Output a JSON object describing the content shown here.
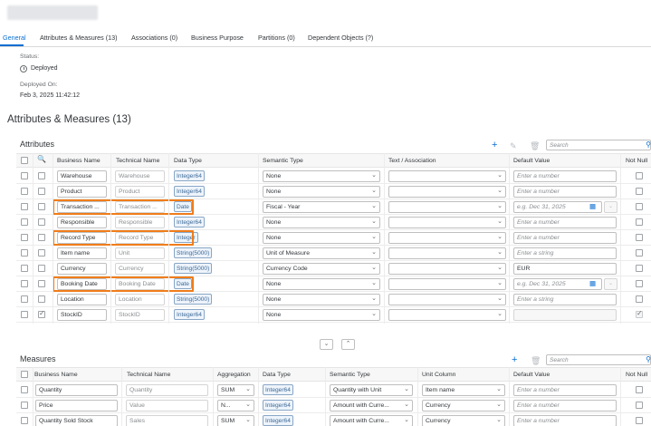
{
  "tabs": [
    {
      "label": "General",
      "active": true
    },
    {
      "label": "Attributes & Measures (13)"
    },
    {
      "label": "Associations (0)"
    },
    {
      "label": "Business Purpose"
    },
    {
      "label": "Partitions (0)"
    },
    {
      "label": "Dependent Objects (?)"
    }
  ],
  "general": {
    "status_label": "Status:",
    "status_value": "Deployed",
    "deployed_on_label": "Deployed On:",
    "deployed_on_value": "Feb 3, 2025 11:42:12"
  },
  "section_title": "Attributes & Measures (13)",
  "attributes": {
    "title": "Attributes",
    "search_placeholder": "Search",
    "headers": [
      "Business Name",
      "Technical Name",
      "Data Type",
      "Semantic Type",
      "Text / Association",
      "Default Value",
      "Not Null"
    ],
    "rows": [
      {
        "key": false,
        "business": "Warehouse",
        "technical": "Warehouse",
        "type": "Integer64",
        "semantic": "None",
        "text": "",
        "default": "Enter a number",
        "default_ph": true,
        "date": false,
        "notnull": false,
        "hl": false
      },
      {
        "key": false,
        "business": "Product",
        "technical": "Product",
        "type": "Integer64",
        "semantic": "None",
        "text": "",
        "default": "Enter a number",
        "default_ph": true,
        "date": false,
        "notnull": false,
        "hl": false
      },
      {
        "key": false,
        "business": "Transaction ...",
        "technical": "Transaction ...",
        "type": "Date",
        "semantic": "Fiscal - Year",
        "text": "",
        "default": "e.g. Dec 31, 2025",
        "default_ph": true,
        "date": true,
        "notnull": false,
        "hl": true
      },
      {
        "key": false,
        "business": "Responsible",
        "technical": "Responsible",
        "type": "Integer64",
        "semantic": "None",
        "text": "",
        "default": "Enter a number",
        "default_ph": true,
        "date": false,
        "notnull": false,
        "hl": false
      },
      {
        "key": false,
        "business": "Record Type",
        "technical": "Record Type",
        "type": "Integer",
        "semantic": "None",
        "text": "",
        "default": "Enter a number",
        "default_ph": true,
        "date": false,
        "notnull": false,
        "hl": true
      },
      {
        "key": false,
        "business": "Item name",
        "technical": "Unit",
        "type": "String(5000)",
        "semantic": "Unit of Measure",
        "text": "",
        "default": "Enter a string",
        "default_ph": true,
        "date": false,
        "notnull": false,
        "hl": false
      },
      {
        "key": false,
        "business": "Currency",
        "technical": "Currency",
        "type": "String(5000)",
        "semantic": "Currency Code",
        "text": "",
        "default": "EUR",
        "default_ph": false,
        "date": false,
        "notnull": false,
        "hl": false
      },
      {
        "key": false,
        "business": "Booking Date",
        "technical": "Booking Date",
        "type": "Date",
        "semantic": "None",
        "text": "",
        "default": "e.g. Dec 31, 2025",
        "default_ph": true,
        "date": true,
        "notnull": false,
        "hl": true
      },
      {
        "key": false,
        "business": "Location",
        "technical": "Location",
        "type": "String(5000)",
        "semantic": "None",
        "text": "",
        "default": "Enter a string",
        "default_ph": true,
        "date": false,
        "notnull": false,
        "hl": false
      },
      {
        "key": true,
        "business": "StockID",
        "technical": "StockID",
        "type": "Integer64",
        "semantic": "None",
        "text": "",
        "default": "",
        "default_ph": false,
        "date": false,
        "notnull": true,
        "hl": false
      }
    ]
  },
  "measures": {
    "title": "Measures",
    "search_placeholder": "Search",
    "headers": [
      "Business Name",
      "Technical Name",
      "Aggregation",
      "Data Type",
      "Semantic Type",
      "Unit Column",
      "Default Value",
      "Not Null"
    ],
    "rows": [
      {
        "business": "Quantity",
        "technical": "Quantity",
        "aggregation": "SUM",
        "type": "Integer64",
        "semantic": "Quantity with Unit",
        "unit": "Item name",
        "default": "Enter a number"
      },
      {
        "business": "Price",
        "technical": "Value",
        "aggregation": "N...",
        "type": "Integer64",
        "semantic": "Amount with Curre...",
        "unit": "Currency",
        "default": "Enter a number"
      },
      {
        "business": "Quantity Sold Stock",
        "technical": "Sales",
        "aggregation": "SUM",
        "type": "Integer64",
        "semantic": "Amount with Curre...",
        "unit": "Currency",
        "default": "Enter a number"
      }
    ]
  },
  "colors": {
    "accent": "#0a6ed1",
    "highlight": "#f07d1a"
  },
  "icons": {
    "add": "plus-icon",
    "edit": "edit-icon",
    "delete": "trash-icon",
    "search": "magnifier-icon",
    "key": "key-icon",
    "status": "clock-icon",
    "calendar": "calendar-icon"
  }
}
